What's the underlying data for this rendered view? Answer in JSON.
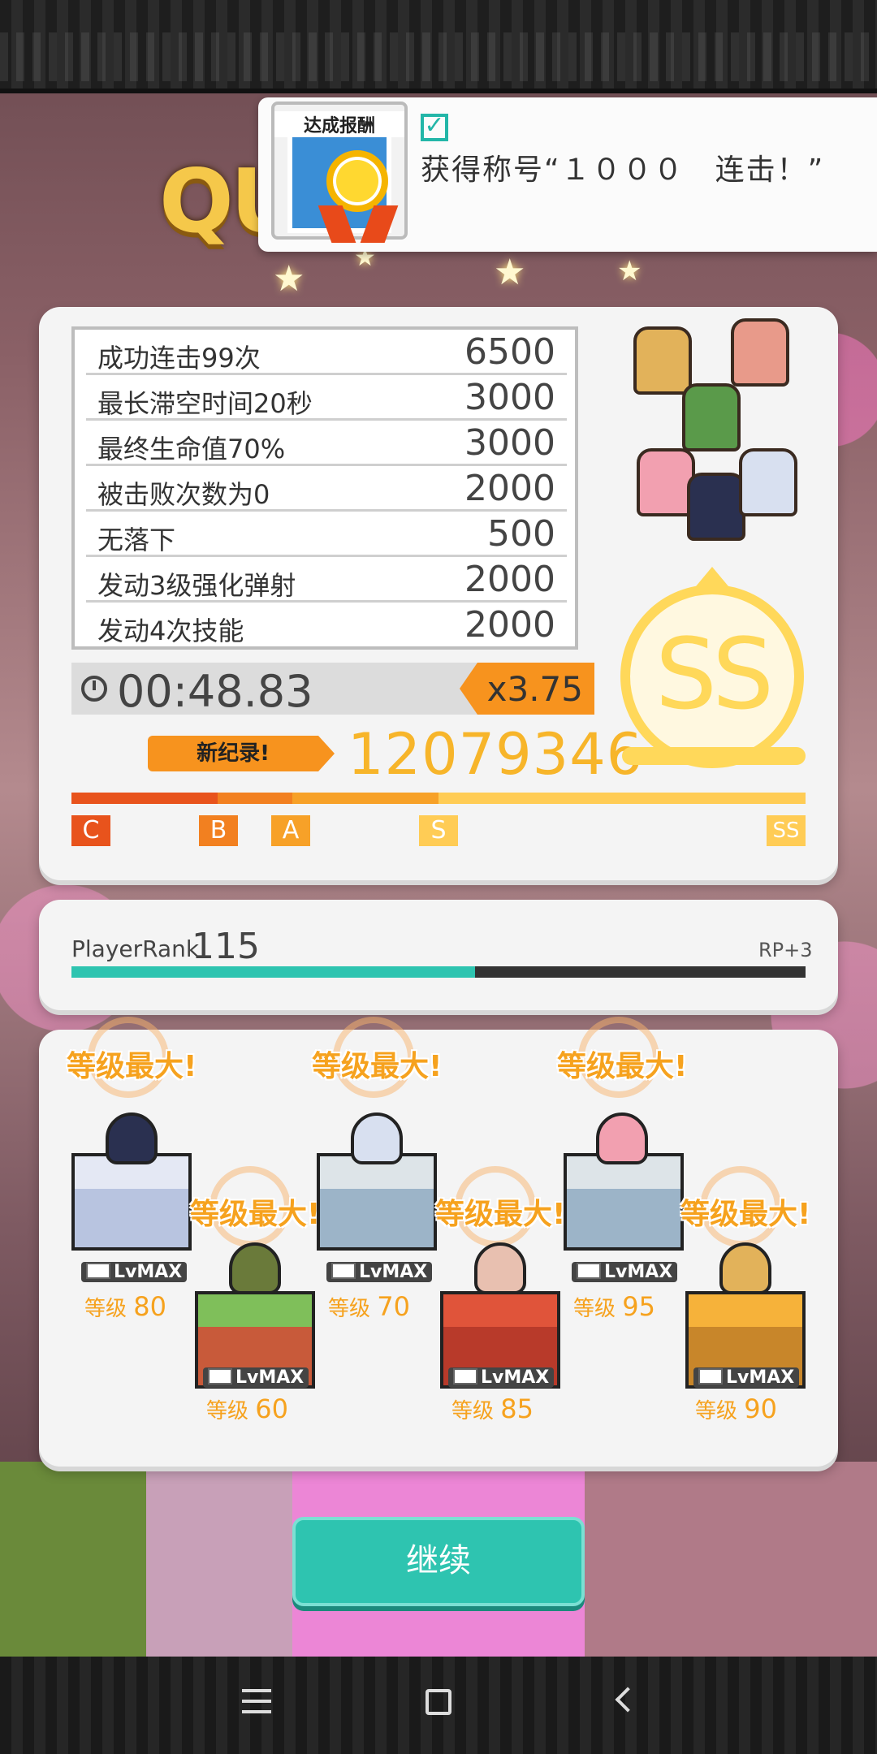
{
  "header": {
    "title_partial": "QU"
  },
  "notification": {
    "badge_label": "达成报酬",
    "check_icon": "check-icon",
    "text": "获得称号“１０００　连击！”"
  },
  "results": {
    "rows": [
      {
        "label": "成功连击99次",
        "value": "6500"
      },
      {
        "label": "最长滞空时间20秒",
        "value": "3000"
      },
      {
        "label": "最终生命值70%",
        "value": "3000"
      },
      {
        "label": "被击败次数为0",
        "value": "2000"
      },
      {
        "label": "无落下",
        "value": "500"
      },
      {
        "label": "发动3级强化弹射",
        "value": "2000"
      },
      {
        "label": "发动4次技能",
        "value": "2000"
      }
    ],
    "time": "00:48.83",
    "multiplier": "x3.75",
    "record_label": "新纪录!",
    "total_score": "12079346",
    "rank": "SS",
    "grades": [
      "C",
      "B",
      "A",
      "S",
      "SS"
    ],
    "score_progress": 1.0,
    "colors": {
      "c": "#e8531c",
      "b": "#f28020",
      "a": "#f7a128",
      "s": "#ffcc55"
    }
  },
  "player": {
    "rank_label": "PlayerRank",
    "rank_value": "115",
    "rp": "RP+3",
    "progress": 0.55
  },
  "units": [
    {
      "max_label": "等级最大!",
      "lv_badge": "LvMAX",
      "level_prefix": "等级",
      "level": "80",
      "color": "#c8d0e8"
    },
    {
      "max_label": "等级最大!",
      "lv_badge": "LvMAX",
      "level_prefix": "等级",
      "level": "60",
      "color": "#7fbf5a"
    },
    {
      "max_label": "等级最大!",
      "lv_badge": "LvMAX",
      "level_prefix": "等级",
      "level": "70",
      "color": "#c8d8e0"
    },
    {
      "max_label": "等级最大!",
      "lv_badge": "LvMAX",
      "level_prefix": "等级",
      "level": "85",
      "color": "#e0543a"
    },
    {
      "max_label": "等级最大!",
      "lv_badge": "LvMAX",
      "level_prefix": "等级",
      "level": "95",
      "color": "#c8d8e0"
    },
    {
      "max_label": "等级最大!",
      "lv_badge": "LvMAX",
      "level_prefix": "等级",
      "level": "90",
      "color": "#f6b23a"
    }
  ],
  "continue_label": "继续",
  "nav": {
    "menu_icon": "menu-icon",
    "home_icon": "home-icon",
    "back_icon": "back-icon"
  }
}
